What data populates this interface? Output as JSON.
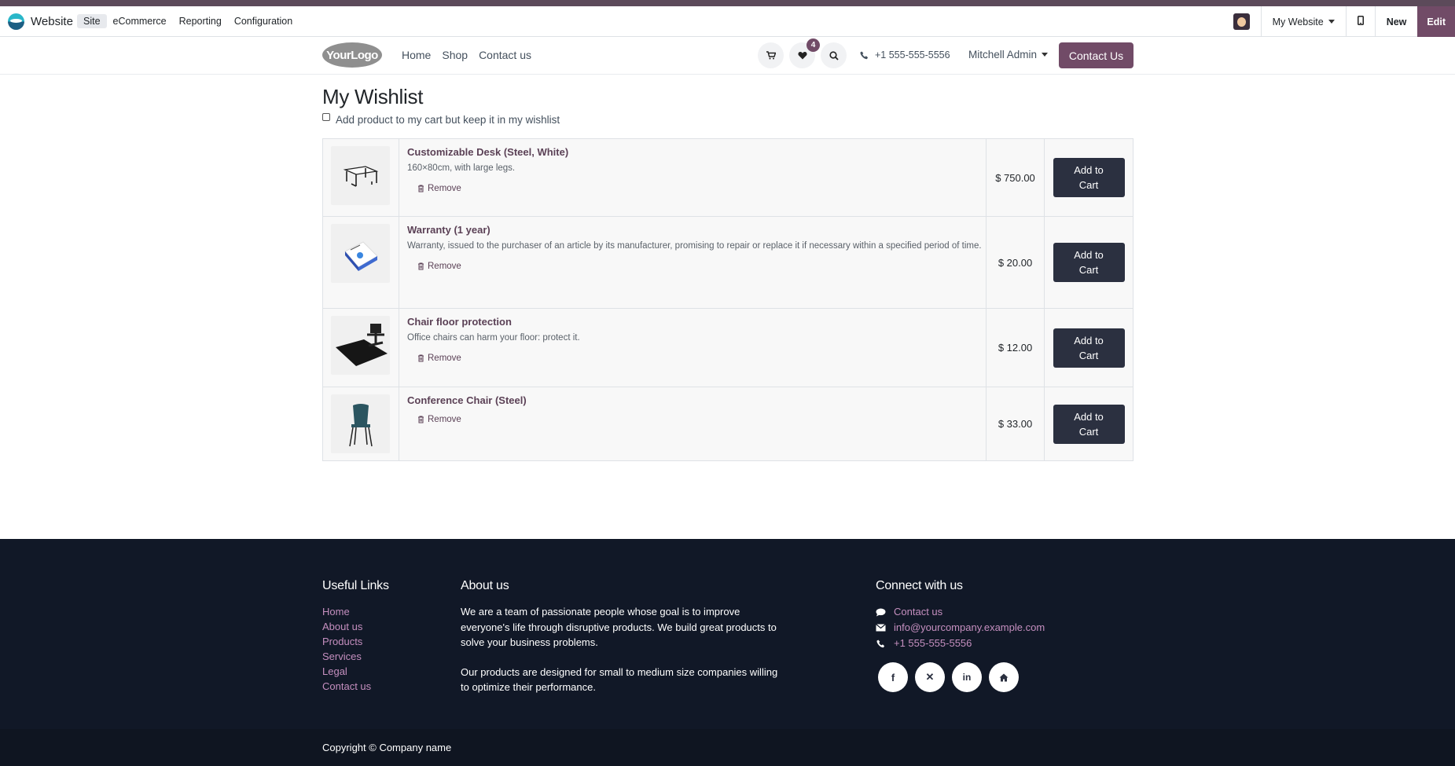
{
  "admin_bar": {
    "app_name": "Website",
    "menu": [
      "Site",
      "eCommerce",
      "Reporting",
      "Configuration"
    ],
    "active_menu": "Site",
    "website_selector": "My Website",
    "new_label": "New",
    "edit_label": "Edit"
  },
  "header": {
    "logo_text": "YourLogo",
    "nav": [
      "Home",
      "Shop",
      "Contact us"
    ],
    "wishlist_count": "4",
    "phone": "+1 555-555-5556",
    "user": "Mitchell Admin",
    "contact_button": "Contact Us"
  },
  "wishlist": {
    "title": "My Wishlist",
    "keep_option": "Add product to my cart but keep it in my wishlist",
    "remove_label": "Remove",
    "add_label": "Add to Cart",
    "items": [
      {
        "name": "Customizable Desk (Steel, White)",
        "description": "160×80cm, with large legs.",
        "price": "$ 750.00",
        "icon": "desk-icon"
      },
      {
        "name": "Warranty (1 year)",
        "description": "Warranty, issued to the purchaser of an article by its manufacturer, promising to repair or replace it if necessary within a specified period of time.",
        "price": "$ 20.00",
        "icon": "warranty-box-icon"
      },
      {
        "name": "Chair floor protection",
        "description": "Office chairs can harm your floor: protect it.",
        "price": "$ 12.00",
        "icon": "chair-mat-icon"
      },
      {
        "name": "Conference Chair (Steel)",
        "description": "",
        "price": "$ 33.00",
        "icon": "chair-icon"
      }
    ]
  },
  "footer": {
    "useful_links_title": "Useful Links",
    "links": [
      "Home",
      "About us",
      "Products",
      "Services",
      "Legal",
      "Contact us"
    ],
    "about_title": "About us",
    "about_p1": "We are a team of passionate people whose goal is to improve everyone's life through disruptive products. We build great products to solve your business problems.",
    "about_p2": "Our products are designed for small to medium size companies willing to optimize their performance.",
    "connect_title": "Connect with us",
    "contact_link": "Contact us",
    "email": "info@yourcompany.example.com",
    "phone": "+1 555-555-5556",
    "social": [
      "facebook-icon",
      "x-icon",
      "linkedin-icon",
      "home-icon"
    ],
    "copyright": "Copyright © Company name"
  },
  "colors": {
    "brand": "#714b67",
    "footer_bg": "#111827",
    "link": "#c58fbf",
    "button_dark": "#2b3040"
  }
}
